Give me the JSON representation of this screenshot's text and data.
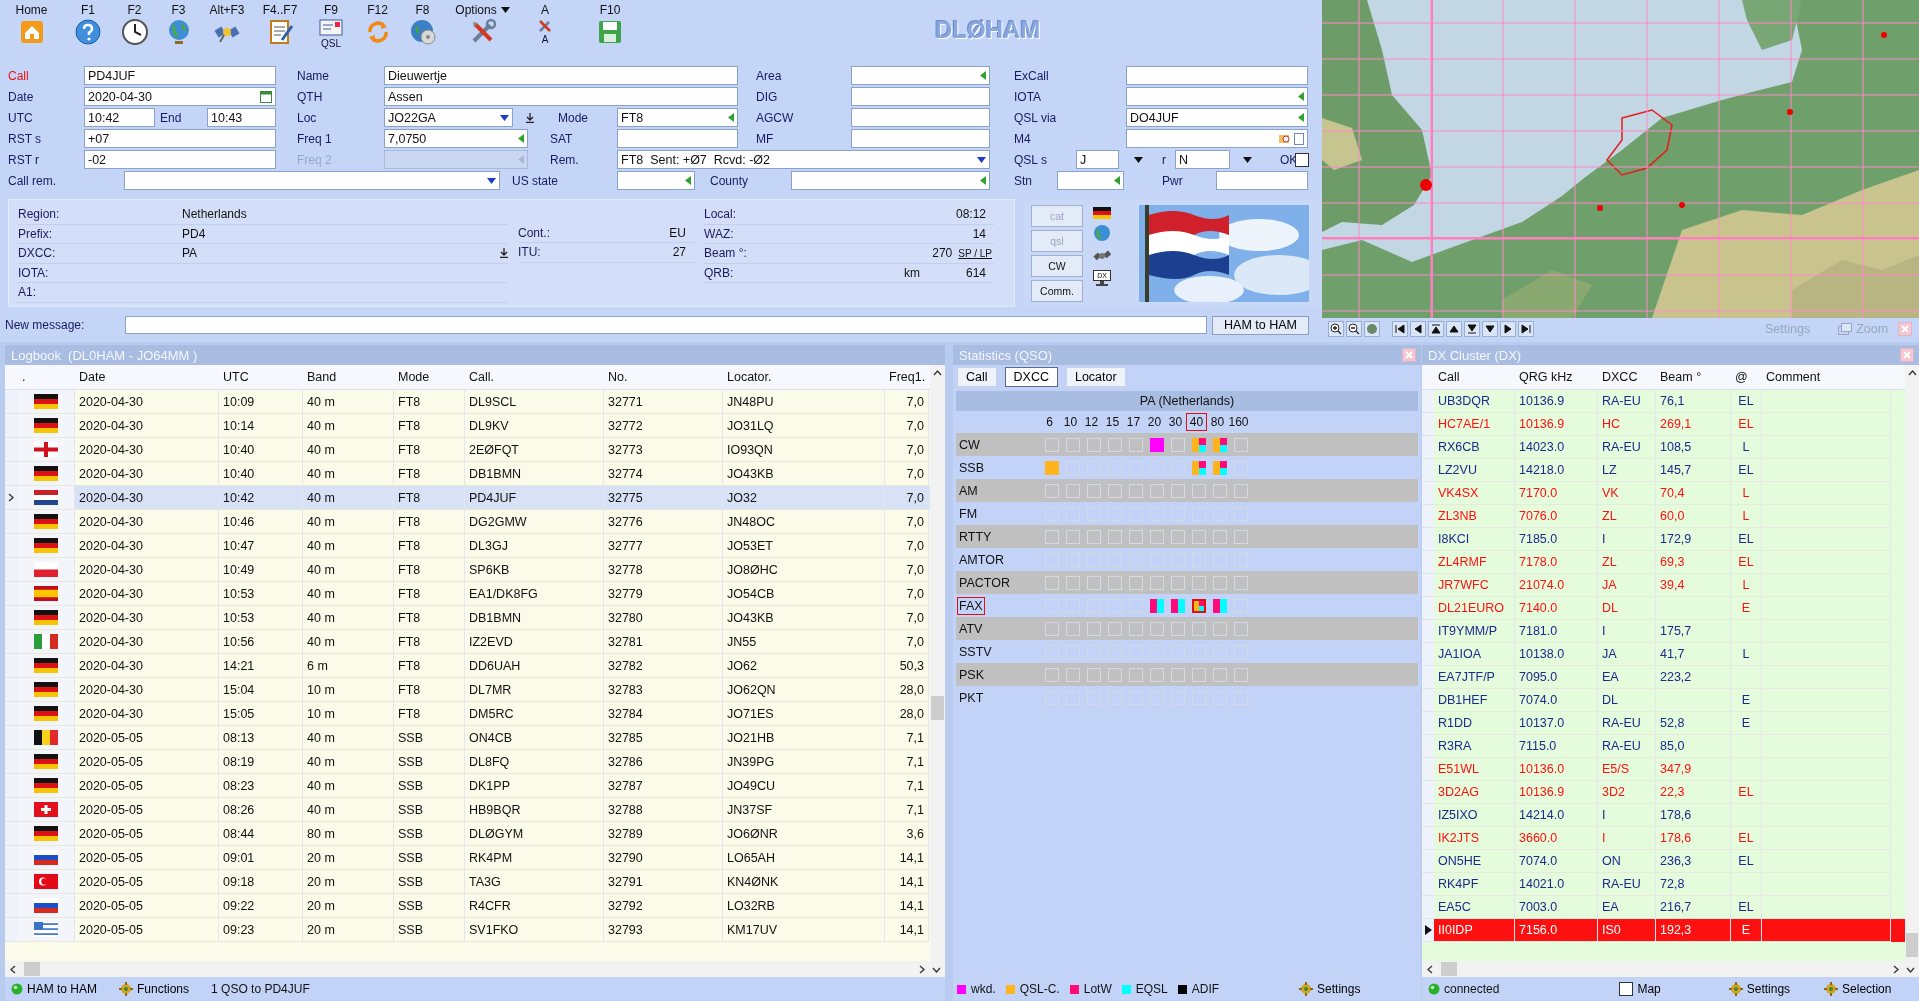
{
  "toolbar": [
    {
      "key": "Home",
      "kind": "home"
    },
    {
      "key": "F1",
      "kind": "help"
    },
    {
      "key": "F2",
      "kind": "clock"
    },
    {
      "key": "F3",
      "kind": "globe"
    },
    {
      "key": "Alt+F3",
      "kind": "satellite"
    },
    {
      "key": "F4..F7",
      "kind": "notepad"
    },
    {
      "key": "F9",
      "kind": "card",
      "caption": "QSL"
    },
    {
      "key": "F12",
      "kind": "refresh"
    },
    {
      "key": "F8",
      "kind": "disc"
    },
    {
      "key": "Options",
      "kind": "tools",
      "menu": true
    },
    {
      "key": "A",
      "kind": "tools",
      "caption": "A",
      "menu": false
    },
    {
      "key": "F10",
      "kind": "save"
    }
  ],
  "logo": "DLØHAM",
  "form": {
    "fields": [
      {
        "label": "Call",
        "kind": "text",
        "value": "PD4JUF",
        "alert": true
      },
      {
        "label": "Name",
        "kind": "text",
        "value": "Dieuwertje",
        "alert": false
      },
      {
        "label": "Area",
        "kind": "list",
        "alert": false
      },
      {
        "label": "ExCall",
        "kind": "text",
        "alert": false
      },
      {
        "label": "Date",
        "kind": "date",
        "value": "2020-04-30",
        "alert": false
      },
      {
        "label": "QTH",
        "kind": "text",
        "value": "Assen",
        "alert": false
      },
      {
        "label": "DIG",
        "kind": "text",
        "alert": false
      },
      {
        "label": "IOTA",
        "kind": "list",
        "alert": false
      },
      {
        "label": "UTC",
        "kind": "text",
        "value": "10:42",
        "alert": false
      },
      {
        "label": "End",
        "kind": "text",
        "value": "10:43",
        "alert": false
      },
      {
        "label": "Loc",
        "kind": "combo",
        "value": "JO22GA",
        "download": true,
        "alert": false
      },
      {
        "label": "Mode",
        "kind": "list",
        "value": "FT8",
        "alert": false
      },
      {
        "label": "AGCW",
        "kind": "text",
        "alert": false
      },
      {
        "label": "QSL via",
        "kind": "list",
        "value": "DO4JUF",
        "alert": false
      },
      {
        "label": "RST s",
        "kind": "text",
        "value": "+07",
        "alert": false
      },
      {
        "label": "Freq 1",
        "kind": "list",
        "value": "7,0750",
        "alert": false
      },
      {
        "label": "SAT",
        "kind": "text",
        "alert": false
      },
      {
        "label": "MF",
        "kind": "text",
        "alert": false
      },
      {
        "label": "M4",
        "kind": "file",
        "alert": false
      },
      {
        "label": "RST r",
        "kind": "text",
        "value": "-02",
        "alert": false
      },
      {
        "label": "Freq 2",
        "kind": "list",
        "disabled": true,
        "alert": false
      },
      {
        "label": "Rem.",
        "kind": "combo",
        "value": "FT8  Sent: +Ø7  Rcvd: -Ø2",
        "alert": false
      },
      {
        "label": "QSL s",
        "kind": "text",
        "value": "J",
        "dropdown": true,
        "alert": false
      },
      {
        "label": "r",
        "kind": "text",
        "value": "N",
        "dropdown": true,
        "alert": false
      },
      {
        "label": "OK",
        "kind": "check",
        "checked": false,
        "alert": false
      },
      {
        "label": "Call rem.",
        "kind": "combo",
        "alert": false
      },
      {
        "label": "US state",
        "kind": "list",
        "alert": false
      },
      {
        "label": "County",
        "kind": "list",
        "alert": false
      },
      {
        "label": "Stn",
        "kind": "list",
        "alert": false
      },
      {
        "label": "Pwr",
        "kind": "text",
        "alert": false
      }
    ]
  },
  "info": {
    "left": [
      {
        "label": "Region:",
        "value": "Netherlands"
      },
      {
        "label": "Prefix:",
        "value": "PD4"
      },
      {
        "label": "DXCC:",
        "value": "PA",
        "kind": "download"
      },
      {
        "label": "IOTA:"
      },
      {
        "label": "A1:"
      }
    ],
    "middle": [
      {
        "label": "Cont.:",
        "value": "EU"
      },
      {
        "label": "ITU:",
        "value": "27"
      }
    ],
    "right": [
      {
        "label": "Local:",
        "value": "08:12"
      },
      {
        "label": "WAZ:",
        "value": "14"
      },
      {
        "label": "Beam °:",
        "value": "270",
        "link": "SP / LP"
      },
      {
        "label": "QRB:",
        "unit": "km",
        "value": "614"
      }
    ]
  },
  "side_buttons": [
    {
      "label": "cat",
      "disabled": true
    },
    {
      "label": "qsl",
      "disabled": true
    },
    {
      "label": "CW",
      "disabled": false
    },
    {
      "label": "Comm.",
      "disabled": false
    }
  ],
  "side_icons": [
    {
      "kind": "flag"
    },
    {
      "kind": "globe"
    },
    {
      "kind": "satellite"
    },
    {
      "kind": "monitor",
      "text": "DX"
    }
  ],
  "message": {
    "label": "New message:",
    "button": "HAM to HAM"
  },
  "map": {
    "actions": [
      {
        "label": "Settings",
        "disabled": true
      },
      {
        "label": "Zoom",
        "disabled": true
      }
    ]
  },
  "logbook": {
    "title": "Logbook  (DL0HAM - JO64MM )",
    "columns": [
      ".",
      "Date",
      "UTC",
      "Band",
      "Mode",
      "Call.",
      "No.",
      "Locator.",
      "Freq1."
    ],
    "rows": [
      {
        "kind": "de",
        "date": "2020-04-30",
        "utc": "10:09",
        "band": "40 m",
        "mode": "FT8",
        "call": "DL9SCL",
        "no": "32771",
        "locator": "JN48PU",
        "freq": "7,0",
        "selected": false
      },
      {
        "kind": "de",
        "date": "2020-04-30",
        "utc": "10:14",
        "band": "40 m",
        "mode": "FT8",
        "call": "DL9KV",
        "no": "32772",
        "locator": "JO31LQ",
        "freq": "7,0",
        "selected": false
      },
      {
        "kind": "gb",
        "date": "2020-04-30",
        "utc": "10:40",
        "band": "40 m",
        "mode": "FT8",
        "call": "2EØFQT",
        "no": "32773",
        "locator": "IO93QN",
        "freq": "7,0",
        "selected": false
      },
      {
        "kind": "de",
        "date": "2020-04-30",
        "utc": "10:40",
        "band": "40 m",
        "mode": "FT8",
        "call": "DB1BMN",
        "no": "32774",
        "locator": "JO43KB",
        "freq": "7,0",
        "selected": false
      },
      {
        "kind": "nl",
        "date": "2020-04-30",
        "utc": "10:42",
        "band": "40 m",
        "mode": "FT8",
        "call": "PD4JUF",
        "no": "32775",
        "locator": "JO32",
        "freq": "7,0",
        "selected": true
      },
      {
        "kind": "de",
        "date": "2020-04-30",
        "utc": "10:46",
        "band": "40 m",
        "mode": "FT8",
        "call": "DG2GMW",
        "no": "32776",
        "locator": "JN48OC",
        "freq": "7,0",
        "selected": false
      },
      {
        "kind": "de",
        "date": "2020-04-30",
        "utc": "10:47",
        "band": "40 m",
        "mode": "FT8",
        "call": "DL3GJ",
        "no": "32777",
        "locator": "JO53ET",
        "freq": "7,0",
        "selected": false
      },
      {
        "kind": "pl",
        "date": "2020-04-30",
        "utc": "10:49",
        "band": "40 m",
        "mode": "FT8",
        "call": "SP6KB",
        "no": "32778",
        "locator": "JO8ØHC",
        "freq": "7,0",
        "selected": false
      },
      {
        "kind": "es",
        "date": "2020-04-30",
        "utc": "10:53",
        "band": "40 m",
        "mode": "FT8",
        "call": "EA1/DK8FG",
        "no": "32779",
        "locator": "JO54CB",
        "freq": "7,0",
        "selected": false
      },
      {
        "kind": "de",
        "date": "2020-04-30",
        "utc": "10:53",
        "band": "40 m",
        "mode": "FT8",
        "call": "DB1BMN",
        "no": "32780",
        "locator": "JO43KB",
        "freq": "7,0",
        "selected": false
      },
      {
        "kind": "it",
        "date": "2020-04-30",
        "utc": "10:56",
        "band": "40 m",
        "mode": "FT8",
        "call": "IZ2EVD",
        "no": "32781",
        "locator": "JN55",
        "freq": "7,0",
        "selected": false
      },
      {
        "kind": "de",
        "date": "2020-04-30",
        "utc": "14:21",
        "band": "6 m",
        "mode": "FT8",
        "call": "DD6UAH",
        "no": "32782",
        "locator": "JO62",
        "freq": "50,3",
        "selected": false
      },
      {
        "kind": "de",
        "date": "2020-04-30",
        "utc": "15:04",
        "band": "10 m",
        "mode": "FT8",
        "call": "DL7MR",
        "no": "32783",
        "locator": "JO62QN",
        "freq": "28,0",
        "selected": false
      },
      {
        "kind": "de",
        "date": "2020-04-30",
        "utc": "15:05",
        "band": "10 m",
        "mode": "FT8",
        "call": "DM5RC",
        "no": "32784",
        "locator": "JO71ES",
        "freq": "28,0",
        "selected": false
      },
      {
        "kind": "be",
        "date": "2020-05-05",
        "utc": "08:13",
        "band": "40 m",
        "mode": "SSB",
        "call": "ON4CB",
        "no": "32785",
        "locator": "JO21HB",
        "freq": "7,1",
        "selected": false
      },
      {
        "kind": "de",
        "date": "2020-05-05",
        "utc": "08:19",
        "band": "40 m",
        "mode": "SSB",
        "call": "DL8FQ",
        "no": "32786",
        "locator": "JN39PG",
        "freq": "7,1",
        "selected": false
      },
      {
        "kind": "de",
        "date": "2020-05-05",
        "utc": "08:23",
        "band": "40 m",
        "mode": "SSB",
        "call": "DK1PP",
        "no": "32787",
        "locator": "JO49CU",
        "freq": "7,1",
        "selected": false
      },
      {
        "kind": "ch",
        "date": "2020-05-05",
        "utc": "08:26",
        "band": "40 m",
        "mode": "SSB",
        "call": "HB9BQR",
        "no": "32788",
        "locator": "JN37SF",
        "freq": "7,1",
        "selected": false
      },
      {
        "kind": "de",
        "date": "2020-05-05",
        "utc": "08:44",
        "band": "80 m",
        "mode": "SSB",
        "call": "DLØGYM",
        "no": "32789",
        "locator": "JO6ØNR",
        "freq": "3,6",
        "selected": false
      },
      {
        "kind": "ru",
        "date": "2020-05-05",
        "utc": "09:01",
        "band": "20 m",
        "mode": "SSB",
        "call": "RK4PM",
        "no": "32790",
        "locator": "LO65AH",
        "freq": "14,1",
        "selected": false
      },
      {
        "kind": "tr",
        "date": "2020-05-05",
        "utc": "09:18",
        "band": "20 m",
        "mode": "SSB",
        "call": "TA3G",
        "no": "32791",
        "locator": "KN4ØNK",
        "freq": "14,1",
        "selected": false
      },
      {
        "kind": "ru",
        "date": "2020-05-05",
        "utc": "09:22",
        "band": "20 m",
        "mode": "SSB",
        "call": "R4CFR",
        "no": "32792",
        "locator": "LO32RB",
        "freq": "14,1",
        "selected": false
      },
      {
        "kind": "gr",
        "date": "2020-05-05",
        "utc": "09:23",
        "band": "20 m",
        "mode": "SSB",
        "call": "SV1FKO",
        "no": "32793",
        "locator": "KM17UV",
        "freq": "14,1",
        "selected": false
      }
    ],
    "status": [
      {
        "kind": "online",
        "label": "HAM to HAM"
      },
      {
        "kind": "functions",
        "label": "Functions"
      },
      {
        "kind": "text",
        "label": "1 QSO to PD4JUF"
      }
    ]
  },
  "statistics": {
    "title": "Statistics (QSO)",
    "tabs": [
      {
        "label": "Call",
        "selected": false
      },
      {
        "label": "DXCC",
        "selected": true
      },
      {
        "label": "Locator",
        "selected": false
      }
    ],
    "heading": "PA (Netherlands)",
    "bands": [
      {
        "label": "6",
        "selected": false
      },
      {
        "label": "10",
        "selected": false
      },
      {
        "label": "12",
        "selected": false
      },
      {
        "label": "15",
        "selected": false
      },
      {
        "label": "17",
        "selected": false
      },
      {
        "label": "20",
        "selected": false
      },
      {
        "label": "30",
        "selected": false
      },
      {
        "label": "40",
        "selected": true
      },
      {
        "label": "80",
        "selected": false
      },
      {
        "label": "160",
        "selected": false
      }
    ],
    "modes": [
      {
        "label": "CW",
        "selected": false,
        "cells": [
          {
            "wkd": false,
            "qsl": false,
            "lotw": false,
            "eqsl": false
          },
          {
            "wkd": false,
            "qsl": false,
            "lotw": false,
            "eqsl": false
          },
          {
            "wkd": false,
            "qsl": false,
            "lotw": false,
            "eqsl": false
          },
          {
            "wkd": false,
            "qsl": false,
            "lotw": false,
            "eqsl": false
          },
          {
            "wkd": false,
            "qsl": false,
            "lotw": false,
            "eqsl": false
          },
          {
            "wkd": true,
            "qsl": false,
            "lotw": false,
            "eqsl": false
          },
          {
            "wkd": false,
            "qsl": false,
            "lotw": false,
            "eqsl": false
          },
          {
            "wkd": false,
            "qsl": true,
            "lotw": true,
            "eqsl": true
          },
          {
            "wkd": false,
            "qsl": true,
            "lotw": true,
            "eqsl": true
          },
          {
            "wkd": false,
            "qsl": false,
            "lotw": false,
            "eqsl": false
          }
        ]
      },
      {
        "label": "SSB",
        "selected": false,
        "cells": [
          {
            "wkd": false,
            "qsl": true,
            "lotw": false,
            "eqsl": false
          },
          {
            "wkd": false,
            "qsl": false,
            "lotw": false,
            "eqsl": false
          },
          {
            "wkd": false,
            "qsl": false,
            "lotw": false,
            "eqsl": false
          },
          {
            "wkd": false,
            "qsl": false,
            "lotw": false,
            "eqsl": false
          },
          {
            "wkd": false,
            "qsl": false,
            "lotw": false,
            "eqsl": false
          },
          {
            "wkd": false,
            "qsl": false,
            "lotw": false,
            "eqsl": false
          },
          {
            "wkd": false,
            "qsl": false,
            "lotw": false,
            "eqsl": false
          },
          {
            "wkd": false,
            "qsl": true,
            "lotw": true,
            "eqsl": true
          },
          {
            "wkd": false,
            "qsl": true,
            "lotw": true,
            "eqsl": true
          },
          {
            "wkd": false,
            "qsl": false,
            "lotw": false,
            "eqsl": false
          }
        ]
      },
      {
        "label": "AM",
        "selected": false,
        "cells": [
          {
            "wkd": false,
            "qsl": false,
            "lotw": false,
            "eqsl": false
          },
          {
            "wkd": false,
            "qsl": false,
            "lotw": false,
            "eqsl": false
          },
          {
            "wkd": false,
            "qsl": false,
            "lotw": false,
            "eqsl": false
          },
          {
            "wkd": false,
            "qsl": false,
            "lotw": false,
            "eqsl": false
          },
          {
            "wkd": false,
            "qsl": false,
            "lotw": false,
            "eqsl": false
          },
          {
            "wkd": false,
            "qsl": false,
            "lotw": false,
            "eqsl": false
          },
          {
            "wkd": false,
            "qsl": false,
            "lotw": false,
            "eqsl": false
          },
          {
            "wkd": false,
            "qsl": false,
            "lotw": false,
            "eqsl": false
          },
          {
            "wkd": false,
            "qsl": false,
            "lotw": false,
            "eqsl": false
          },
          {
            "wkd": false,
            "qsl": false,
            "lotw": false,
            "eqsl": false
          }
        ]
      },
      {
        "label": "FM",
        "selected": false,
        "cells": [
          {
            "wkd": false,
            "qsl": false,
            "lotw": false,
            "eqsl": false
          },
          {
            "wkd": false,
            "qsl": false,
            "lotw": false,
            "eqsl": false
          },
          {
            "wkd": false,
            "qsl": false,
            "lotw": false,
            "eqsl": false
          },
          {
            "wkd": false,
            "qsl": false,
            "lotw": false,
            "eqsl": false
          },
          {
            "wkd": false,
            "qsl": false,
            "lotw": false,
            "eqsl": false
          },
          {
            "wkd": false,
            "qsl": false,
            "lotw": false,
            "eqsl": false
          },
          {
            "wkd": false,
            "qsl": false,
            "lotw": false,
            "eqsl": false
          },
          {
            "wkd": false,
            "qsl": false,
            "lotw": false,
            "eqsl": false
          },
          {
            "wkd": false,
            "qsl": false,
            "lotw": false,
            "eqsl": false
          },
          {
            "wkd": false,
            "qsl": false,
            "lotw": false,
            "eqsl": false
          }
        ]
      },
      {
        "label": "RTTY",
        "selected": false,
        "cells": [
          {
            "wkd": false,
            "qsl": false,
            "lotw": false,
            "eqsl": false
          },
          {
            "wkd": false,
            "qsl": false,
            "lotw": false,
            "eqsl": false
          },
          {
            "wkd": false,
            "qsl": false,
            "lotw": false,
            "eqsl": false
          },
          {
            "wkd": false,
            "qsl": false,
            "lotw": false,
            "eqsl": false
          },
          {
            "wkd": false,
            "qsl": false,
            "lotw": false,
            "eqsl": false
          },
          {
            "wkd": false,
            "qsl": false,
            "lotw": false,
            "eqsl": false
          },
          {
            "wkd": false,
            "qsl": false,
            "lotw": false,
            "eqsl": false
          },
          {
            "wkd": false,
            "qsl": false,
            "lotw": false,
            "eqsl": false
          },
          {
            "wkd": false,
            "qsl": false,
            "lotw": false,
            "eqsl": false
          },
          {
            "wkd": false,
            "qsl": false,
            "lotw": false,
            "eqsl": false
          }
        ]
      },
      {
        "label": "AMTOR",
        "selected": false,
        "cells": [
          {
            "wkd": false,
            "qsl": false,
            "lotw": false,
            "eqsl": false
          },
          {
            "wkd": false,
            "qsl": false,
            "lotw": false,
            "eqsl": false
          },
          {
            "wkd": false,
            "qsl": false,
            "lotw": false,
            "eqsl": false
          },
          {
            "wkd": false,
            "qsl": false,
            "lotw": false,
            "eqsl": false
          },
          {
            "wkd": false,
            "qsl": false,
            "lotw": false,
            "eqsl": false
          },
          {
            "wkd": false,
            "qsl": false,
            "lotw": false,
            "eqsl": false
          },
          {
            "wkd": false,
            "qsl": false,
            "lotw": false,
            "eqsl": false
          },
          {
            "wkd": false,
            "qsl": false,
            "lotw": false,
            "eqsl": false
          },
          {
            "wkd": false,
            "qsl": false,
            "lotw": false,
            "eqsl": false
          },
          {
            "wkd": false,
            "qsl": false,
            "lotw": false,
            "eqsl": false
          }
        ]
      },
      {
        "label": "PACTOR",
        "selected": false,
        "cells": [
          {
            "wkd": false,
            "qsl": false,
            "lotw": false,
            "eqsl": false
          },
          {
            "wkd": false,
            "qsl": false,
            "lotw": false,
            "eqsl": false
          },
          {
            "wkd": false,
            "qsl": false,
            "lotw": false,
            "eqsl": false
          },
          {
            "wkd": false,
            "qsl": false,
            "lotw": false,
            "eqsl": false
          },
          {
            "wkd": false,
            "qsl": false,
            "lotw": false,
            "eqsl": false
          },
          {
            "wkd": false,
            "qsl": false,
            "lotw": false,
            "eqsl": false
          },
          {
            "wkd": false,
            "qsl": false,
            "lotw": false,
            "eqsl": false
          },
          {
            "wkd": false,
            "qsl": false,
            "lotw": false,
            "eqsl": false
          },
          {
            "wkd": false,
            "qsl": false,
            "lotw": false,
            "eqsl": false
          },
          {
            "wkd": false,
            "qsl": false,
            "lotw": false,
            "eqsl": false
          }
        ]
      },
      {
        "label": "FAX",
        "selected": true,
        "cells": [
          {
            "wkd": false,
            "qsl": false,
            "lotw": false,
            "eqsl": false
          },
          {
            "wkd": false,
            "qsl": false,
            "lotw": false,
            "eqsl": false
          },
          {
            "wkd": false,
            "qsl": false,
            "lotw": false,
            "eqsl": false
          },
          {
            "wkd": false,
            "qsl": false,
            "lotw": false,
            "eqsl": false
          },
          {
            "wkd": false,
            "qsl": false,
            "lotw": false,
            "eqsl": false
          },
          {
            "wkd": false,
            "qsl": false,
            "lotw": true,
            "eqsl": true
          },
          {
            "wkd": false,
            "qsl": false,
            "lotw": true,
            "eqsl": true
          },
          {
            "wkd": false,
            "qsl": true,
            "lotw": true,
            "eqsl": true
          },
          {
            "wkd": false,
            "qsl": false,
            "lotw": true,
            "eqsl": true
          },
          {
            "wkd": false,
            "qsl": false,
            "lotw": false,
            "eqsl": false
          }
        ]
      },
      {
        "label": "ATV",
        "selected": false,
        "cells": [
          {
            "wkd": false,
            "qsl": false,
            "lotw": false,
            "eqsl": false
          },
          {
            "wkd": false,
            "qsl": false,
            "lotw": false,
            "eqsl": false
          },
          {
            "wkd": false,
            "qsl": false,
            "lotw": false,
            "eqsl": false
          },
          {
            "wkd": false,
            "qsl": false,
            "lotw": false,
            "eqsl": false
          },
          {
            "wkd": false,
            "qsl": false,
            "lotw": false,
            "eqsl": false
          },
          {
            "wkd": false,
            "qsl": false,
            "lotw": false,
            "eqsl": false
          },
          {
            "wkd": false,
            "qsl": false,
            "lotw": false,
            "eqsl": false
          },
          {
            "wkd": false,
            "qsl": false,
            "lotw": false,
            "eqsl": false
          },
          {
            "wkd": false,
            "qsl": false,
            "lotw": false,
            "eqsl": false
          },
          {
            "wkd": false,
            "qsl": false,
            "lotw": false,
            "eqsl": false
          }
        ]
      },
      {
        "label": "SSTV",
        "selected": false,
        "cells": [
          {
            "wkd": false,
            "qsl": false,
            "lotw": false,
            "eqsl": false
          },
          {
            "wkd": false,
            "qsl": false,
            "lotw": false,
            "eqsl": false
          },
          {
            "wkd": false,
            "qsl": false,
            "lotw": false,
            "eqsl": false
          },
          {
            "wkd": false,
            "qsl": false,
            "lotw": false,
            "eqsl": false
          },
          {
            "wkd": false,
            "qsl": false,
            "lotw": false,
            "eqsl": false
          },
          {
            "wkd": false,
            "qsl": false,
            "lotw": false,
            "eqsl": false
          },
          {
            "wkd": false,
            "qsl": false,
            "lotw": false,
            "eqsl": false
          },
          {
            "wkd": false,
            "qsl": false,
            "lotw": false,
            "eqsl": false
          },
          {
            "wkd": false,
            "qsl": false,
            "lotw": false,
            "eqsl": false
          },
          {
            "wkd": false,
            "qsl": false,
            "lotw": false,
            "eqsl": false
          }
        ]
      },
      {
        "label": "PSK",
        "selected": false,
        "cells": [
          {
            "wkd": false,
            "qsl": false,
            "lotw": false,
            "eqsl": false
          },
          {
            "wkd": false,
            "qsl": false,
            "lotw": false,
            "eqsl": false
          },
          {
            "wkd": false,
            "qsl": false,
            "lotw": false,
            "eqsl": false
          },
          {
            "wkd": false,
            "qsl": false,
            "lotw": false,
            "eqsl": false
          },
          {
            "wkd": false,
            "qsl": false,
            "lotw": false,
            "eqsl": false
          },
          {
            "wkd": false,
            "qsl": false,
            "lotw": false,
            "eqsl": false
          },
          {
            "wkd": false,
            "qsl": false,
            "lotw": false,
            "eqsl": false
          },
          {
            "wkd": false,
            "qsl": false,
            "lotw": false,
            "eqsl": false
          },
          {
            "wkd": false,
            "qsl": false,
            "lotw": false,
            "eqsl": false
          },
          {
            "wkd": false,
            "qsl": false,
            "lotw": false,
            "eqsl": false
          }
        ]
      },
      {
        "label": "PKT",
        "selected": false,
        "cells": [
          {
            "wkd": false,
            "qsl": false,
            "lotw": false,
            "eqsl": false
          },
          {
            "wkd": false,
            "qsl": false,
            "lotw": false,
            "eqsl": false
          },
          {
            "wkd": false,
            "qsl": false,
            "lotw": false,
            "eqsl": false
          },
          {
            "wkd": false,
            "qsl": false,
            "lotw": false,
            "eqsl": false
          },
          {
            "wkd": false,
            "qsl": false,
            "lotw": false,
            "eqsl": false
          },
          {
            "wkd": false,
            "qsl": false,
            "lotw": false,
            "eqsl": false
          },
          {
            "wkd": false,
            "qsl": false,
            "lotw": false,
            "eqsl": false
          },
          {
            "wkd": false,
            "qsl": false,
            "lotw": false,
            "eqsl": false
          },
          {
            "wkd": false,
            "qsl": false,
            "lotw": false,
            "eqsl": false
          },
          {
            "wkd": false,
            "qsl": false,
            "lotw": false,
            "eqsl": false
          }
        ]
      }
    ],
    "legend": [
      {
        "label": "wkd.",
        "color": "#ff00ff"
      },
      {
        "label": "QSL-C.",
        "color": "#ffb41e"
      },
      {
        "label": "LotW",
        "color": "#ff0a78"
      },
      {
        "label": "EQSL",
        "color": "#00ffff"
      },
      {
        "label": "ADIF",
        "color": "#000000"
      }
    ],
    "settings": "Settings"
  },
  "cluster": {
    "title": "DX Cluster (DX)",
    "columns": [
      "Call",
      "QRG kHz",
      "DXCC",
      "Beam °",
      "@",
      "Comment"
    ],
    "rows": [
      {
        "call": "UB3DQR",
        "qrg": "10136.9",
        "dxcc": "RA-EU",
        "beam": "76,1",
        "at": "EL",
        "color": "#1c2a8c",
        "selected": false
      },
      {
        "call": "HC7AE/1",
        "qrg": "10136.9",
        "dxcc": "HC",
        "beam": "269,1",
        "at": "EL",
        "color": "#ff1010",
        "selected": false
      },
      {
        "call": "RX6CB",
        "qrg": "14023.0",
        "dxcc": "RA-EU",
        "beam": "108,5",
        "at": "L",
        "color": "#1c2a8c",
        "selected": false
      },
      {
        "call": "LZ2VU",
        "qrg": "14218.0",
        "dxcc": "LZ",
        "beam": "145,7",
        "at": "EL",
        "color": "#1c2a8c",
        "selected": false
      },
      {
        "call": "VK4SX",
        "qrg": "7170.0",
        "dxcc": "VK",
        "beam": "70,4",
        "at": "L",
        "color": "#ff1010",
        "selected": false
      },
      {
        "call": "ZL3NB",
        "qrg": "7076.0",
        "dxcc": "ZL",
        "beam": "60,0",
        "at": "L",
        "color": "#ff1010",
        "selected": false
      },
      {
        "call": "I8KCI",
        "qrg": "7185.0",
        "dxcc": "I",
        "beam": "172,9",
        "at": "EL",
        "color": "#1c2a8c",
        "selected": false
      },
      {
        "call": "ZL4RMF",
        "qrg": "7178.0",
        "dxcc": "ZL",
        "beam": "69,3",
        "at": "EL",
        "color": "#ff1010",
        "selected": false
      },
      {
        "call": "JR7WFC",
        "qrg": "21074.0",
        "dxcc": "JA",
        "beam": "39,4",
        "at": "L",
        "color": "#ff1010",
        "selected": false
      },
      {
        "call": "DL21EURO",
        "qrg": "7140.0",
        "dxcc": "DL",
        "at": "E",
        "color": "#ff1010",
        "selected": false
      },
      {
        "call": "IT9YMM/P",
        "qrg": "7181.0",
        "dxcc": "I",
        "beam": "175,7",
        "color": "#1c2a8c",
        "selected": false
      },
      {
        "call": "JA1IOA",
        "qrg": "10138.0",
        "dxcc": "JA",
        "beam": "41,7",
        "at": "L",
        "color": "#1c2a8c",
        "selected": false
      },
      {
        "call": "EA7JTF/P",
        "qrg": "7095.0",
        "dxcc": "EA",
        "beam": "223,2",
        "color": "#1c2a8c",
        "selected": false
      },
      {
        "call": "DB1HEF",
        "qrg": "7074.0",
        "dxcc": "DL",
        "at": "E",
        "color": "#1c2a8c",
        "selected": false
      },
      {
        "call": "R1DD",
        "qrg": "10137.0",
        "dxcc": "RA-EU",
        "beam": "52,8",
        "at": "E",
        "color": "#1c2a8c",
        "selected": false
      },
      {
        "call": "R3RA",
        "qrg": "7115.0",
        "dxcc": "RA-EU",
        "beam": "85,0",
        "color": "#1c2a8c",
        "selected": false
      },
      {
        "call": "E51WL",
        "qrg": "10136.0",
        "dxcc": "E5/S",
        "beam": "347,9",
        "color": "#ff1010",
        "selected": false
      },
      {
        "call": "3D2AG",
        "qrg": "10136.9",
        "dxcc": "3D2",
        "beam": "22,3",
        "at": "EL",
        "color": "#ff1010",
        "selected": false
      },
      {
        "call": "IZ5IXO",
        "qrg": "14214.0",
        "dxcc": "I",
        "beam": "178,6",
        "color": "#1c2a8c",
        "selected": false
      },
      {
        "call": "IK2JTS",
        "qrg": "3660.0",
        "dxcc": "I",
        "beam": "178,6",
        "at": "EL",
        "color": "#ff1010",
        "selected": false
      },
      {
        "call": "ON5HE",
        "qrg": "7074.0",
        "dxcc": "ON",
        "beam": "236,3",
        "at": "EL",
        "color": "#1c2a8c",
        "selected": false
      },
      {
        "call": "RK4PF",
        "qrg": "14021.0",
        "dxcc": "RA-EU",
        "beam": "72,8",
        "color": "#1c2a8c",
        "selected": false
      },
      {
        "call": "EA5C",
        "qrg": "7003.0",
        "dxcc": "EA",
        "beam": "216,7",
        "at": "EL",
        "color": "#1c2a8c",
        "selected": false
      },
      {
        "call": "II0IDP",
        "qrg": "7156.0",
        "dxcc": "IS0",
        "beam": "192,3",
        "at": "E",
        "color": "#ff1010",
        "selected": true
      }
    ],
    "status": {
      "connection": "connected",
      "map": {
        "label": "Map",
        "checked": false
      },
      "settings": "Settings",
      "selection": "Selection"
    }
  }
}
